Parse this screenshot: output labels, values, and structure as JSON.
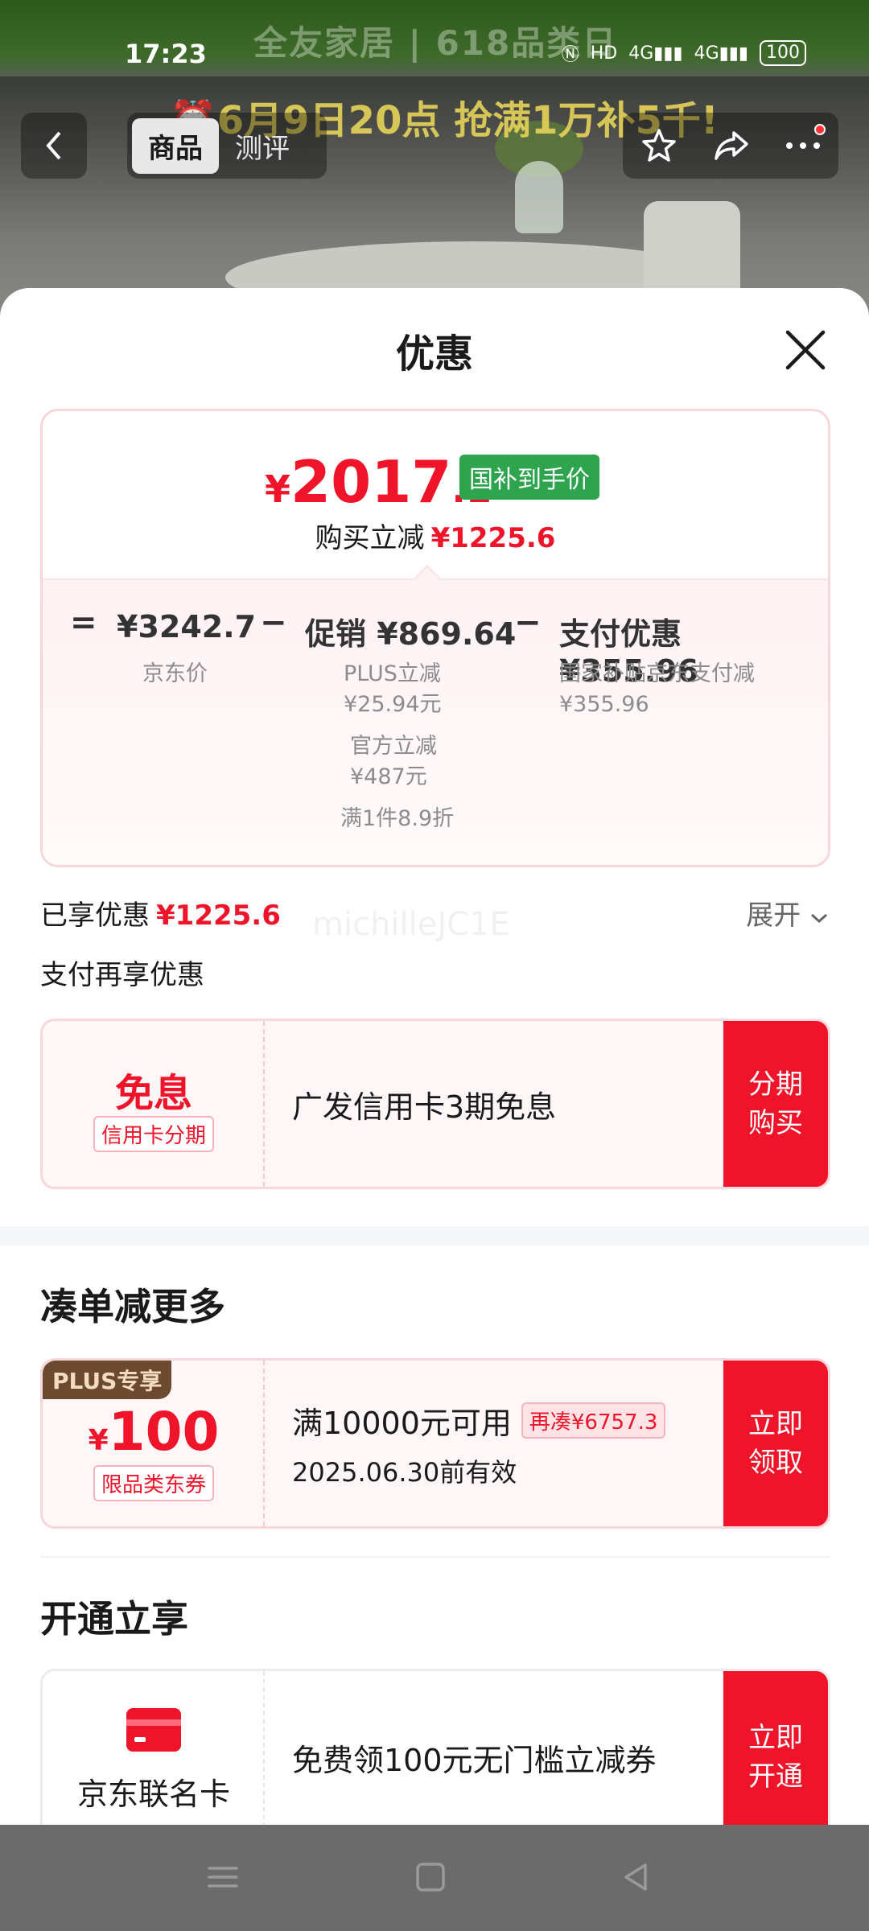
{
  "background": {
    "brand_text": "全友家居 | 618品类日",
    "promo_text": "⏰6月9日20点 抢满1万补5千!"
  },
  "status_bar": {
    "time": "17:23",
    "network_1": "4G",
    "network_2": "4G",
    "hd": "HD",
    "battery": "100"
  },
  "top_nav": {
    "tab_goods": "商品",
    "tab_review": "测评"
  },
  "sheet": {
    "title": "优惠"
  },
  "price_card": {
    "yen": "¥",
    "price_int": "2017",
    "price_dec": ".1",
    "badge": "国补到手价",
    "reduce_label": "购买立减",
    "reduce_value": "¥1225.6",
    "eq": "=",
    "base_price": "¥3242.7",
    "base_label": "京东价",
    "minus": "−",
    "promo_label": "促销 ¥869.64",
    "promo_plus": "PLUS立减",
    "promo_plus_value": "¥25.94元",
    "promo_official": "官方立减",
    "promo_official_value": "¥487元",
    "promo_discount": "满1件8.9折",
    "pay_label": "支付优惠 ¥355.96",
    "pay_detail": "国家补贴京东支付减",
    "pay_detail_value": "¥355.96"
  },
  "enjoyed": {
    "label": "已享优惠",
    "value": "¥1225.6",
    "expand": "展开",
    "watermark": "michilleJC1E"
  },
  "pay_more": {
    "title": "支付再享优惠",
    "free_label": "免息",
    "free_tag": "信用卡分期",
    "desc": "广发信用卡3期免息",
    "action_line1": "分期",
    "action_line2": "购买"
  },
  "more_section": {
    "title": "凑单减更多",
    "plus_badge": "PLUS专享",
    "yen": "¥",
    "amount": "100",
    "coupon_tag": "限品类东券",
    "condition": "满10000元可用",
    "gap_tag": "再凑¥6757.3",
    "expiry": "2025.06.30前有效",
    "action_line1": "立即",
    "action_line2": "领取"
  },
  "open_section": {
    "title": "开通立享",
    "card_label": "京东联名卡",
    "desc": "免费领100元无门槛立减券",
    "action_line1": "立即",
    "action_line2": "开通"
  }
}
